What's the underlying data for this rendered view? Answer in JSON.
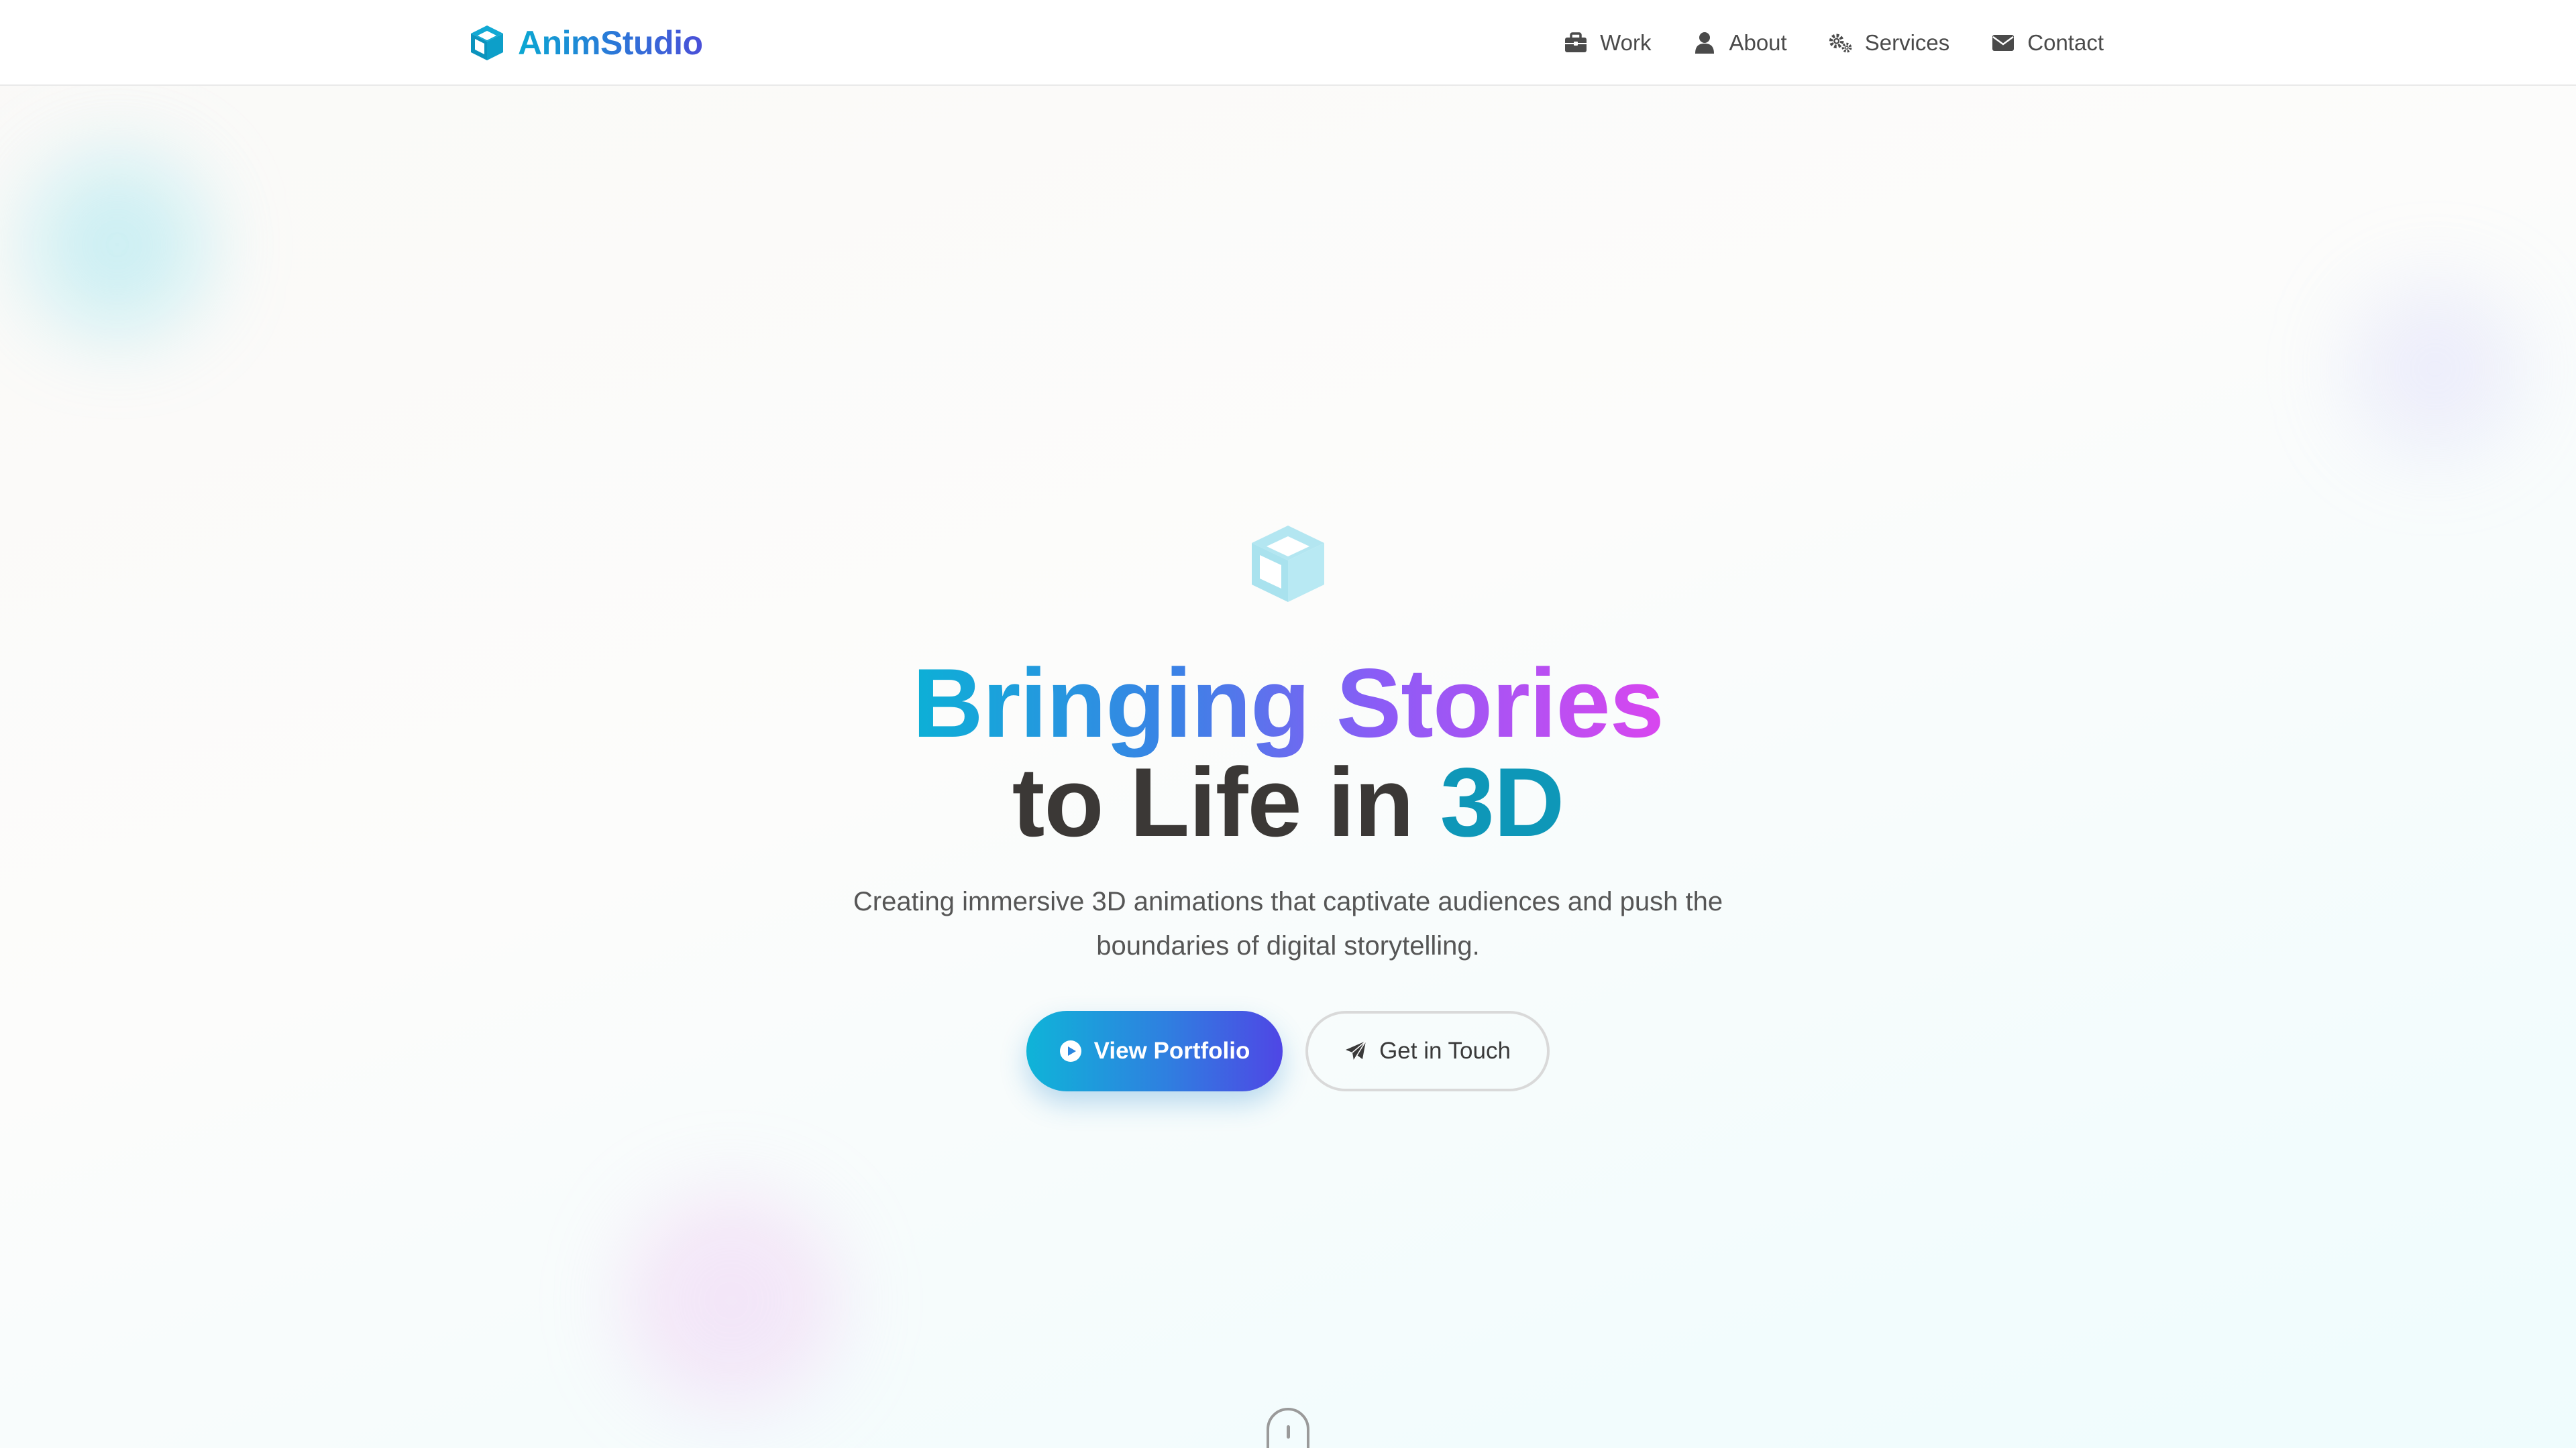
{
  "brand": {
    "name": "AnimStudio",
    "icon": "cube-icon",
    "gradient": [
      "#0aa8d2",
      "#4a4fd8"
    ]
  },
  "nav": {
    "items": [
      {
        "label": "Work",
        "icon": "briefcase-icon"
      },
      {
        "label": "About",
        "icon": "user-icon"
      },
      {
        "label": "Services",
        "icon": "cogs-icon"
      },
      {
        "label": "Contact",
        "icon": "envelope-icon"
      }
    ]
  },
  "hero": {
    "icon": "cube-icon",
    "headline": {
      "gradient_part": "Bringing Stories",
      "plain_part": "to Life in",
      "accent_part": "3D"
    },
    "subtitle_line1": "Creating immersive 3D animations that captivate audiences and push the",
    "subtitle_line2": "boundaries of digital storytelling.",
    "primary_button": {
      "label": "View Portfolio",
      "icon": "play-circle-icon"
    },
    "secondary_button": {
      "label": "Get in Touch",
      "icon": "paper-plane-icon"
    },
    "scroll_indicator_icon": "mouse-icon"
  },
  "colors": {
    "accent_cyan": "#0e97b8",
    "gradient_start": "#0cb0d6",
    "gradient_end": "#d946ef",
    "text_dark": "#3b3836"
  }
}
